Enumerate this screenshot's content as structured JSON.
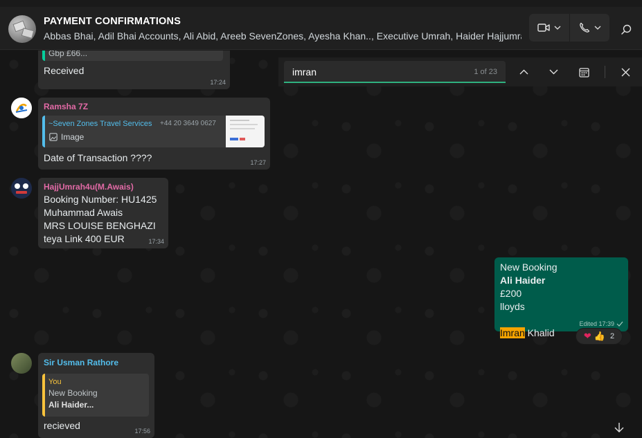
{
  "header": {
    "title": "PAYMENT CONFIRMATIONS",
    "members": "Abbas Bhai, Adil Bhai Accounts, Ali Abid, Areeb SevenZones, Ayesha Khan.., Executive Umrah, Haider Hajjumra..."
  },
  "search": {
    "query": "imran",
    "count": "1 of 23"
  },
  "messages": {
    "m0": {
      "quote": "Gbp £66...",
      "text": "Received",
      "time": "17:24"
    },
    "m1": {
      "sender": "Ramsha 7Z",
      "quote_sender": "~Seven Zones Travel Services",
      "quote_phone": "+44 20 3649 0627",
      "quote_type": "Image",
      "text": "Date of Transaction ????",
      "time": "17:27"
    },
    "m2": {
      "sender": "HajjUmrah4u(M.Awais)",
      "text": "Booking Number: HU1425\nMuhammad Awais\nMRS LOUISE BENGHAZI\nteya Link 400 EUR",
      "time": "17:34"
    },
    "m3": {
      "line1": "New Booking",
      "line2": "Ali Haider",
      "line3": "£200",
      "line4": "lloyds",
      "match": "Imran",
      "rest": " Khalid",
      "time": "Edited 17:39",
      "reaction_count": "2"
    },
    "m4": {
      "sender": "Sir Usman Rathore",
      "quote_sender": "You",
      "quote_line1": "New Booking",
      "quote_line2": "Ali Haider...",
      "text": "recieved",
      "time": "17:56"
    }
  },
  "colors": {
    "accent": "#2fb17f",
    "outgoing_bubble": "#005c4b",
    "incoming_bubble": "#2e2e2e",
    "highlight": "#f5a300",
    "sender_pink": "#e26aa6",
    "sender_blue": "#53bdeb",
    "quote_you": "#f7c23c"
  },
  "icons": [
    "video-call-icon",
    "voice-call-icon",
    "chevron-down-icon",
    "search-icon",
    "chevron-up-icon",
    "calendar-icon",
    "close-icon",
    "image-icon",
    "read-check-icon",
    "arrow-down-icon"
  ]
}
